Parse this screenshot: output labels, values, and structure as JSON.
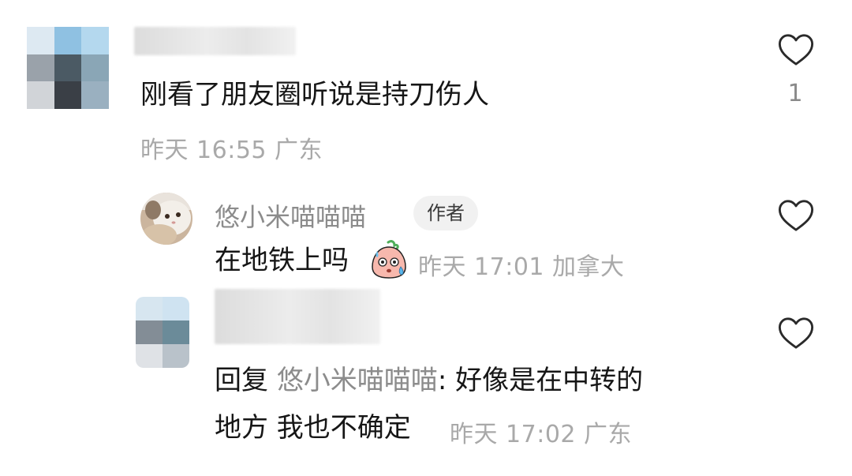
{
  "comments": [
    {
      "text": "刚看了朋友圈听说是持刀伤人",
      "meta": "昨天 16:55 广东",
      "likes": "1",
      "avatar_colors": [
        "#dde9f2",
        "#8fc1e2",
        "#b4d8ee",
        "#9aa2aa",
        "#4b5a64",
        "#8aa6b6",
        "#d1d4d8",
        "#3a3f46",
        "#9ab0c0"
      ]
    }
  ],
  "replies": [
    {
      "username": "悠小米喵喵喵",
      "badge": "作者",
      "text": "在地铁上吗",
      "emoji": "sweating-face-emoji",
      "meta": "昨天 17:01 加拿大"
    },
    {
      "reply_prefix": "回复 ",
      "reply_to": "悠小米喵喵喵",
      "line1": ": 好像是在中转的",
      "line2": "地方 我也不确定",
      "meta": "昨天 17:02 广东",
      "avatar_colors": [
        "#d7e6f0",
        "#cfe3f1",
        "#838d96",
        "#6b8b99",
        "#dfe2e6",
        "#b9c2ca"
      ]
    }
  ],
  "icons": {
    "like": "heart-outline-icon"
  },
  "colors": {
    "meta": "#a9a9a9",
    "username": "#8c8c8c",
    "text": "#161616",
    "badge_bg": "#f1f1f1"
  }
}
